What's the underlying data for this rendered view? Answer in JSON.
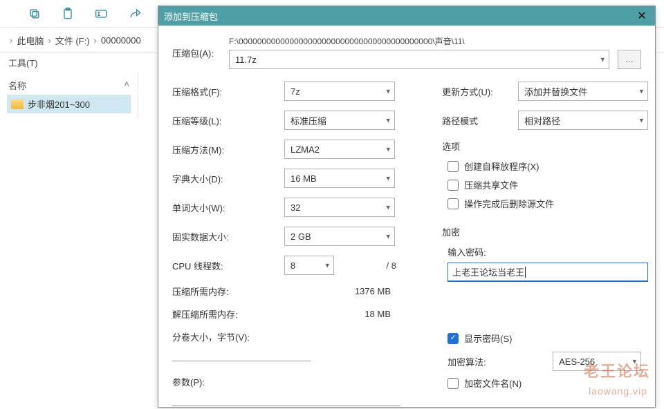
{
  "bg": {
    "breadcrumb": {
      "root_sep": "›",
      "pc": "此电脑",
      "drive": "文件 (F:)",
      "folder": "00000000"
    },
    "menubar": {
      "tools": "工具(T)"
    },
    "list": {
      "header_name": "名称",
      "item": "步非烟201~300"
    }
  },
  "dialog": {
    "title": "添加到压缩包",
    "archive_label": "压缩包(A):",
    "archive_path": "F:\\000000000000000000000000000000000000000000\\声音\\11\\",
    "archive_name": "11.7z",
    "left": {
      "format_lbl": "压缩格式(F):",
      "format_val": "7z",
      "level_lbl": "压缩等级(L):",
      "level_val": "标准压缩",
      "method_lbl": "压缩方法(M):",
      "method_val": "LZMA2",
      "dict_lbl": "字典大小(D):",
      "dict_val": "16 MB",
      "word_lbl": "单词大小(W):",
      "word_val": "32",
      "solid_lbl": "固实数据大小:",
      "solid_val": "2 GB",
      "cpu_lbl": "CPU 线程数:",
      "cpu_val": "8",
      "cpu_total": "/ 8",
      "mem_c_lbl": "压缩所需内存:",
      "mem_c_val": "1376 MB",
      "mem_d_lbl": "解压缩所需内存:",
      "mem_d_val": "18 MB",
      "split_lbl": "分卷大小，字节(V):",
      "param_lbl": "参数(P):"
    },
    "right": {
      "update_lbl": "更新方式(U):",
      "update_val": "添加并替换文件",
      "pathmode_lbl": "路径模式",
      "pathmode_val": "相对路径",
      "options_hdr": "选项",
      "opt_sfx": "创建自释放程序(X)",
      "opt_shared": "压缩共享文件",
      "opt_delete": "操作完成后删除源文件",
      "enc_hdr": "加密",
      "pwd_lbl": "输入密码:",
      "pwd_val": "上老王论坛当老王",
      "show_pwd": "显示密码(S)",
      "algo_lbl": "加密算法:",
      "algo_val": "AES-256",
      "enc_names": "加密文件名(N)"
    }
  },
  "wm": {
    "a": "老王论坛",
    "b": "laowang.vip"
  }
}
